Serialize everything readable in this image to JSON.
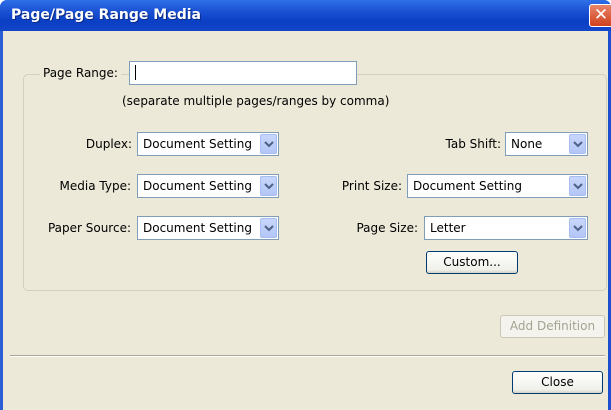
{
  "window": {
    "title": "Page/Page Range Media",
    "close_glyph": "✕"
  },
  "page_range": {
    "label": "Page Range:",
    "value": "",
    "hint": "(separate multiple pages/ranges by comma)"
  },
  "duplex": {
    "label": "Duplex:",
    "value": "Document Setting"
  },
  "media_type": {
    "label": "Media Type:",
    "value": "Document Setting"
  },
  "paper_source": {
    "label": "Paper Source:",
    "value": "Document Setting"
  },
  "tab_shift": {
    "label": "Tab Shift:",
    "value": "None"
  },
  "print_size": {
    "label": "Print Size:",
    "value": "Document Setting"
  },
  "page_size": {
    "label": "Page Size:",
    "value": "Letter"
  },
  "buttons": {
    "custom": "Custom...",
    "add_definition": "Add Definition",
    "close": "Close"
  }
}
